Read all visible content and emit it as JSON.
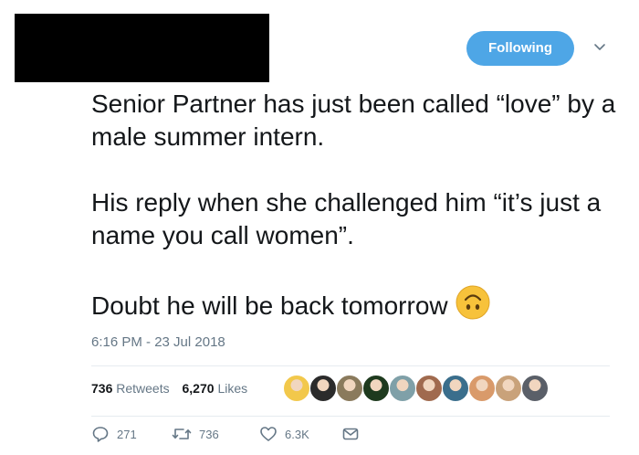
{
  "header": {
    "follow_button": "Following",
    "caret_icon": "chevron-down-icon"
  },
  "tweet": {
    "paragraphs": [
      "Senior Partner has just been called “love” by a male summer intern.",
      "His reply when she challenged him “it’s just a name you call women”.",
      "Doubt he will be back tomorrow"
    ],
    "emoji": "upside-down-face-emoji",
    "timestamp": "6:16 PM - 23 Jul 2018"
  },
  "stats": {
    "retweets_count": "736",
    "retweets_label": "Retweets",
    "likes_count": "6,270",
    "likes_label": "Likes"
  },
  "likers": {
    "avatar_colors": [
      "#f2c84b",
      "#2b2b2b",
      "#8a7a5c",
      "#1e3a1e",
      "#7fa0a8",
      "#a06a4e",
      "#3a6e8c",
      "#d99a6a",
      "#c9a27a",
      "#5a5f68"
    ]
  },
  "actions": {
    "reply_count": "271",
    "retweet_count": "736",
    "like_count": "6.3K",
    "reply_icon": "reply-icon",
    "retweet_icon": "retweet-icon",
    "like_icon": "heart-icon",
    "dm_icon": "envelope-icon"
  },
  "colors": {
    "accent": "#4ea6e6",
    "muted": "#657786",
    "text": "#14171a"
  }
}
